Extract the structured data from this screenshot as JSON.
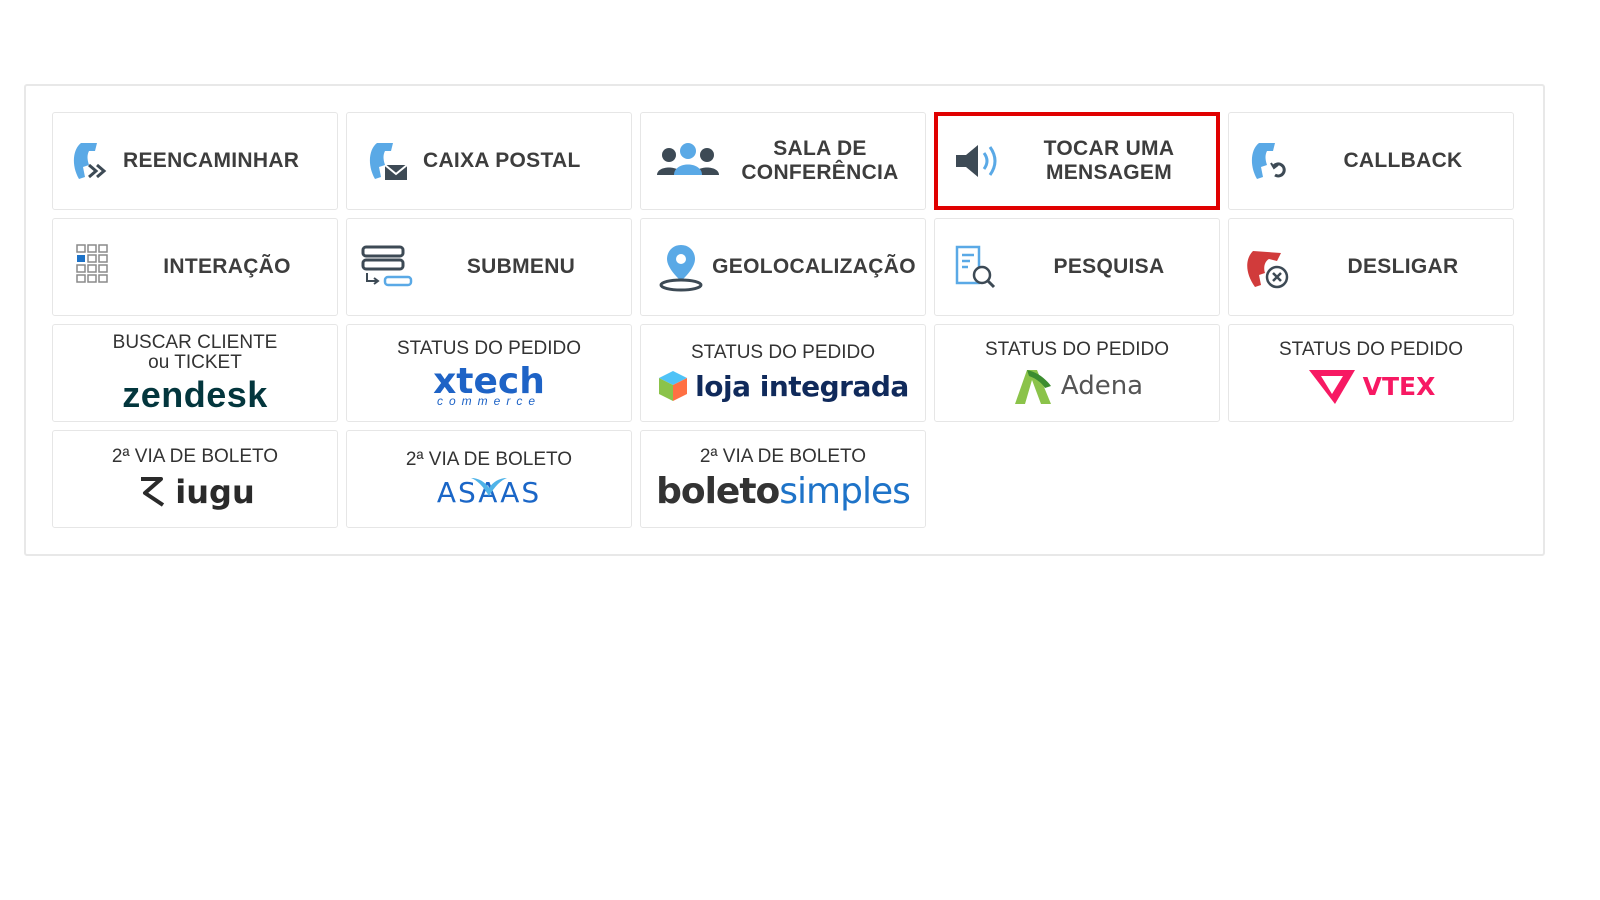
{
  "actions": [
    {
      "id": "reencaminhar",
      "label": "REENCAMINHAR",
      "icon": "phone-forward-icon"
    },
    {
      "id": "caixa-postal",
      "label": "CAIXA POSTAL",
      "icon": "phone-mail-icon"
    },
    {
      "id": "sala-conferencia",
      "label": "SALA DE\nCONFERÊNCIA",
      "icon": "group-icon"
    },
    {
      "id": "tocar-mensagem",
      "label": "TOCAR UMA\nMENSAGEM",
      "icon": "speaker-icon",
      "selected": true
    },
    {
      "id": "callback",
      "label": "CALLBACK",
      "icon": "phone-refresh-icon"
    },
    {
      "id": "interacao",
      "label": "INTERAÇÃO",
      "icon": "keypad-icon"
    },
    {
      "id": "submenu",
      "label": "SUBMENU",
      "icon": "submenu-icon"
    },
    {
      "id": "geolocalizacao",
      "label": "GEOLOCALIZAÇÃO",
      "icon": "map-pin-icon"
    },
    {
      "id": "pesquisa",
      "label": "PESQUISA",
      "icon": "document-search-icon"
    },
    {
      "id": "desligar",
      "label": "DESLIGAR",
      "icon": "hangup-icon"
    }
  ],
  "integrations": [
    {
      "id": "zendesk",
      "top_label": "BUSCAR CLIENTE\nou TICKET",
      "logo_text": "zendesk"
    },
    {
      "id": "xtech",
      "top_label": "STATUS DO PEDIDO",
      "logo_text": "xtech",
      "logo_sub": "commerce"
    },
    {
      "id": "loja-integrada",
      "top_label": "STATUS DO PEDIDO",
      "logo_text": "loja integrada"
    },
    {
      "id": "adena",
      "top_label": "STATUS DO PEDIDO",
      "logo_text": "Adena"
    },
    {
      "id": "vtex",
      "top_label": "STATUS DO PEDIDO",
      "logo_text": "VTEX"
    },
    {
      "id": "iugu",
      "top_label": "2ª VIA DE BOLETO",
      "logo_text": "iugu"
    },
    {
      "id": "asaas",
      "top_label": "2ª VIA DE BOLETO",
      "logo_text": "ASAAS"
    },
    {
      "id": "boleto-simples",
      "top_label": "2ª VIA DE BOLETO",
      "logo_text_a": "boleto",
      "logo_text_b": "simples"
    }
  ],
  "colors": {
    "icon_blue": "#5aa9e6",
    "icon_dark": "#3d4a55",
    "hangup_red": "#d13b3b",
    "selected_border": "#e00000"
  }
}
